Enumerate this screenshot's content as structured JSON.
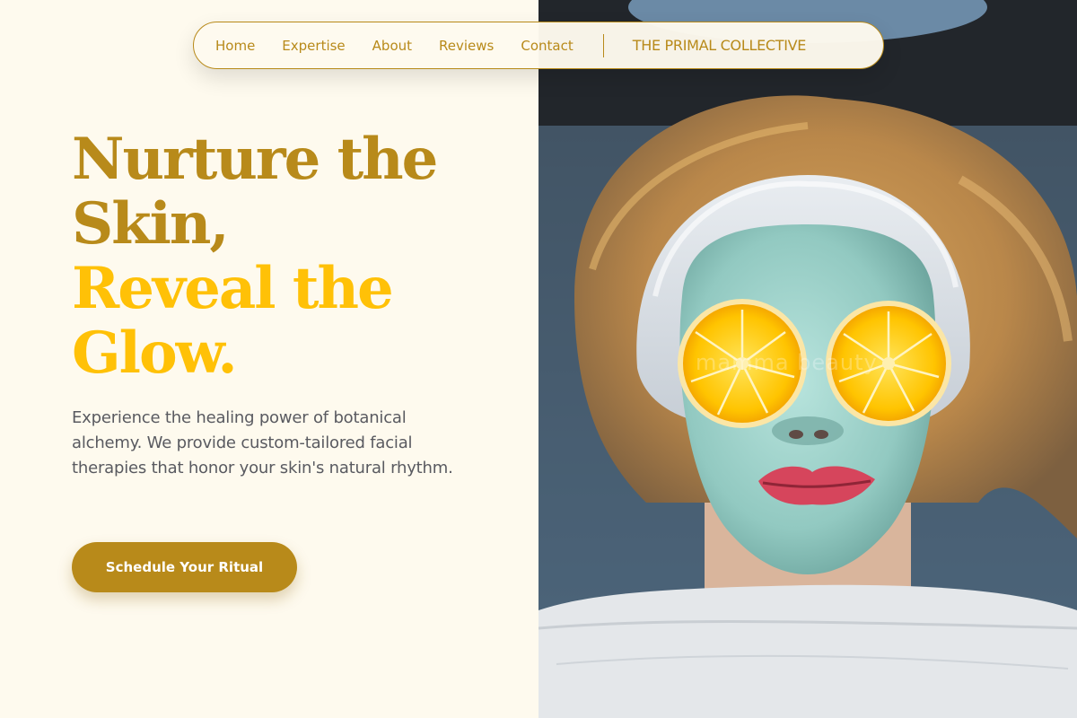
{
  "nav": {
    "links": [
      "Home",
      "Expertise",
      "About",
      "Reviews",
      "Contact"
    ],
    "brand": "THE PRIMAL COLLECTIVE"
  },
  "hero": {
    "headline_line1": "Nurture the",
    "headline_line2": "Skin,",
    "headline_line3": "Reveal the",
    "headline_line4": "Glow.",
    "description": "Experience the healing power of botanical alchemy. We provide custom-tailored facial therapies that honor your skin's natural rhythm.",
    "cta_label": "Schedule Your Ritual"
  },
  "image": {
    "subject": "woman with a teal clay face mask, lemon slices over eyes and a white towel headband",
    "watermark": "mamma beauty"
  },
  "colors": {
    "background": "#fefaee",
    "gold": "#b88a1a",
    "yellow": "#ffc107",
    "body_text": "#595a60"
  }
}
